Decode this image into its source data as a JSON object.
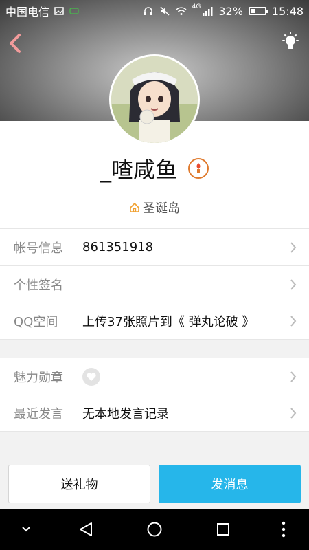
{
  "status_bar": {
    "carrier": "中国电信",
    "network": "4G",
    "battery": "32%",
    "battery_level": 0.32,
    "time": "15:48"
  },
  "header": {
    "back_icon": "chevron-left-icon",
    "right_icon": "lightbulb-icon"
  },
  "profile": {
    "nickname": "_喳咸鱼",
    "location": "圣诞岛"
  },
  "info_rows": [
    {
      "label": "帐号信息",
      "value": "861351918"
    },
    {
      "label": "个性签名",
      "value": ""
    },
    {
      "label": "QQ空间",
      "value": "上传37张照片到《 弹丸论破 》"
    }
  ],
  "extra_rows": [
    {
      "label": "魅力勋章",
      "value": ""
    },
    {
      "label": "最近发言",
      "value": "无本地发言记录"
    }
  ],
  "actions": {
    "gift_label": "送礼物",
    "message_label": "发消息"
  },
  "colors": {
    "accent": "#26b6ea",
    "badge": "#e07b2f"
  }
}
